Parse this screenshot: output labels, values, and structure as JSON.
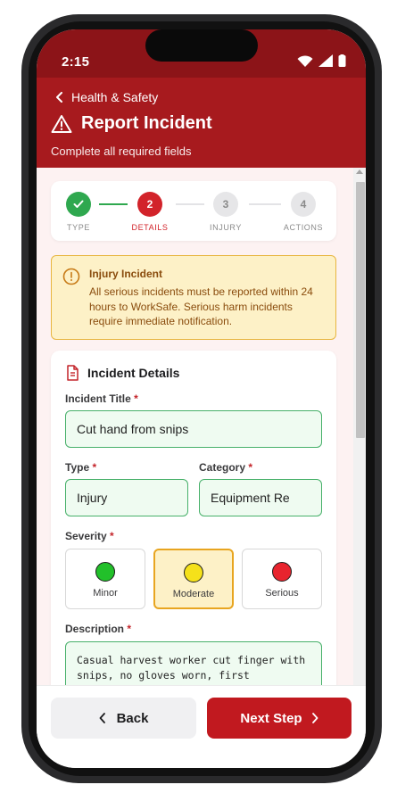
{
  "status": {
    "time": "2:15"
  },
  "header": {
    "back_label": "Health & Safety",
    "title": "Report Incident",
    "subtitle": "Complete all required fields"
  },
  "stepper": {
    "steps": [
      {
        "number": "",
        "label": "TYPE",
        "state": "complete"
      },
      {
        "number": "2",
        "label": "DETAILS",
        "state": "active"
      },
      {
        "number": "3",
        "label": "INJURY",
        "state": "upcoming"
      },
      {
        "number": "4",
        "label": "ACTIONS",
        "state": "upcoming"
      }
    ]
  },
  "alert": {
    "title": "Injury Incident",
    "body": "All serious incidents must be reported within 24 hours to WorkSafe. Serious harm incidents require immediate notification."
  },
  "card": {
    "title": "Incident Details",
    "fields": {
      "title_label": "Incident Title",
      "title_value": "Cut hand from snips",
      "type_label": "Type",
      "type_value": "Injury",
      "category_label": "Category",
      "category_value": "Equipment Re",
      "severity_label": "Severity",
      "description_label": "Description",
      "description_value": "Casual harvest worker cut finger with snips, no gloves worn, first"
    },
    "required_marker": "*",
    "severity_options": [
      {
        "label": "Minor",
        "color": "#22c02a",
        "selected": false
      },
      {
        "label": "Moderate",
        "color": "#f5e11a",
        "selected": true
      },
      {
        "label": "Serious",
        "color": "#e8242e",
        "selected": false
      }
    ]
  },
  "footer": {
    "back_label": "Back",
    "next_label": "Next Step"
  },
  "colors": {
    "brand_dark": "#8c1418",
    "brand": "#a71a1e",
    "accent_green": "#47b06a",
    "warning_bg": "#fdf1c7"
  },
  "icons": [
    "wifi-icon",
    "signal-icon",
    "battery-icon",
    "chevron-left-icon",
    "warning-triangle-icon",
    "check-icon",
    "info-circle-icon",
    "document-icon",
    "chevron-right-icon"
  ]
}
